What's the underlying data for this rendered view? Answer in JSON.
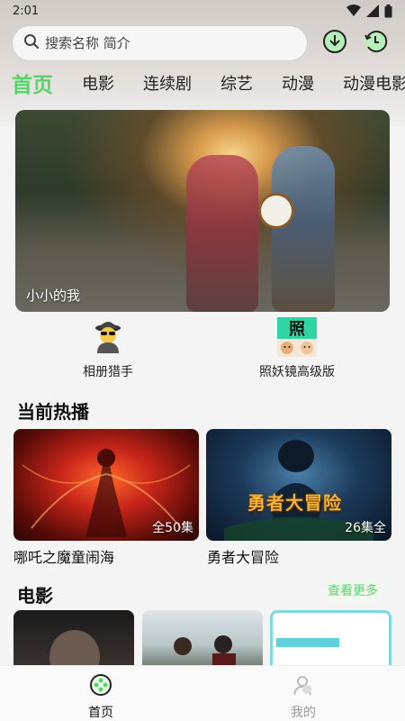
{
  "status": {
    "time": "2:01"
  },
  "search": {
    "placeholder": "搜索名称 简介"
  },
  "tabs": [
    "首页",
    "电影",
    "连续剧",
    "综艺",
    "动漫",
    "动漫电影"
  ],
  "banner": {
    "title": "小小的我"
  },
  "quick_links": [
    {
      "label": "相册猎手",
      "icon": "spy-icon"
    },
    {
      "label": "照妖镜高级版",
      "icon": "mirror-app-icon",
      "icon_text": "照"
    }
  ],
  "hot": {
    "title": "当前热播",
    "items": [
      {
        "title": "哪吒之魔童闹海",
        "badge": "全50集"
      },
      {
        "title": "勇者大冒险",
        "badge": "26集全",
        "poster_text": "勇者大冒险"
      }
    ]
  },
  "movies": {
    "title": "电影",
    "more_label": "查看更多"
  },
  "bottom_nav": [
    {
      "label": "首页",
      "active": true
    },
    {
      "label": "我的",
      "active": false
    }
  ],
  "colors": {
    "accent": "#59d26a"
  }
}
